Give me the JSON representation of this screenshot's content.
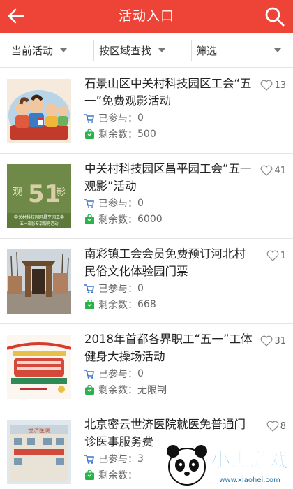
{
  "header": {
    "title": "活动入口",
    "back_icon": "back-arrow-icon",
    "search_icon": "search-icon",
    "color": "#ee4438"
  },
  "filters": [
    {
      "label": "当前活动"
    },
    {
      "label": "按区域查找"
    },
    {
      "label": "筛选"
    }
  ],
  "stats_labels": {
    "joined": "已参与：",
    "remaining": "剩余数："
  },
  "items": [
    {
      "title": "石景山区中关村科技园区工会“五一”免费观影活动",
      "joined": "0",
      "remaining": "500",
      "likes": "13"
    },
    {
      "title": "中关村科技园区昌平园工会“五一观影”活动",
      "joined": "0",
      "remaining": "6000",
      "likes": "41"
    },
    {
      "title": "南彩镇工会会员免费预订河北村民俗文化体验园门票",
      "joined": "0",
      "remaining": "668",
      "likes": "1"
    },
    {
      "title": "2018年首都各界职工“五一”工体健身大操场活动",
      "joined": "0",
      "remaining": "无限制",
      "likes": "31"
    },
    {
      "title": "北京密云世济医院就医免普通门诊医事服务费",
      "joined": "3",
      "remaining": "",
      "likes": "8"
    }
  ],
  "thumb_text": {
    "t2_left": "观",
    "t2_center": "51",
    "t2_right": "影",
    "t2_line1": "中关村科技园区昌平园工会",
    "t2_line2": "五一观影专享服务活动",
    "t5_banner": "世济医院"
  },
  "watermark": {
    "text": "小黑游戏",
    "url": "www.xiaohei.com"
  }
}
